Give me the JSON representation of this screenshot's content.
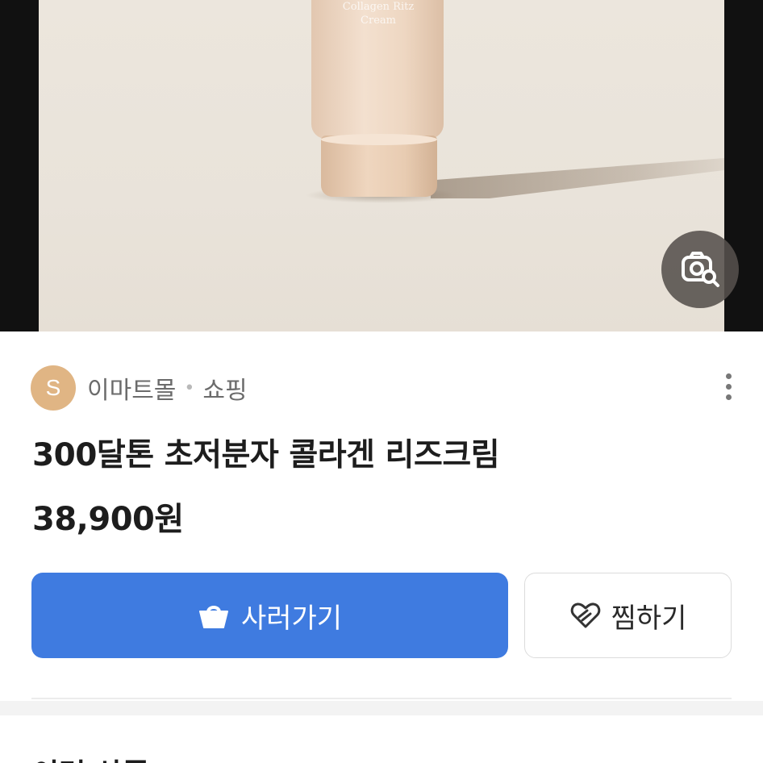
{
  "product_image": {
    "tube_text": "Collagen Ritz Cream",
    "lens_icon": "image-search-icon"
  },
  "seller": {
    "avatar_letter": "S",
    "name": "이마트몰",
    "separator": "•",
    "category": "쇼핑",
    "more_icon": "more-vertical-icon"
  },
  "product": {
    "title": "300달톤 초저분자 콜라겐 리즈크림",
    "price": "38,900원"
  },
  "actions": {
    "buy_label": "사러가기",
    "buy_icon": "shopping-bag-icon",
    "wish_label": "찜하기",
    "wish_icon": "heart-icon"
  },
  "next_section": {
    "title": "이런 상품"
  },
  "colors": {
    "primary_button": "#3f7be0",
    "avatar": "#e0b584"
  }
}
